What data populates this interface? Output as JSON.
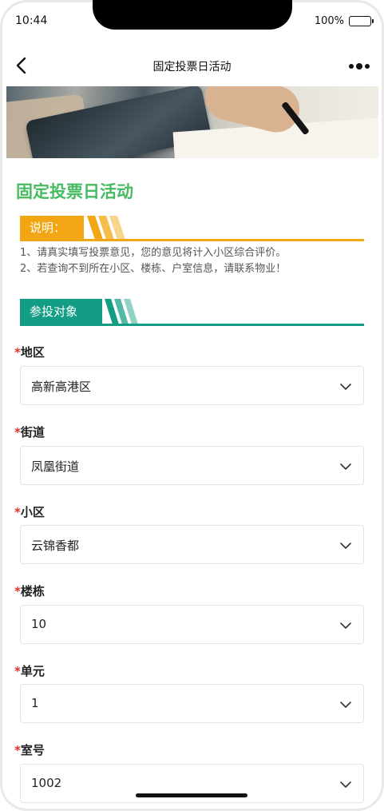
{
  "status_bar": {
    "time": "10:44",
    "battery_percent": "100%",
    "battery_level": 1.0
  },
  "nav": {
    "title": "固定投票日活动",
    "back_icon": "chevron-left-icon",
    "more_icon": "more-dots-icon"
  },
  "page": {
    "title": "固定投票日活动"
  },
  "notice": {
    "header": "说明：",
    "lines": [
      "1、请真实填写投票意见，您的意见将计入小区综合评价。",
      "2、若查询不到所在小区、楼栋、户室信息，请联系物业！"
    ]
  },
  "participant": {
    "header": "参投对象"
  },
  "form": {
    "required_mark": "*",
    "fields": [
      {
        "label": "地区",
        "value": "高新高港区"
      },
      {
        "label": "街道",
        "value": "凤凰街道"
      },
      {
        "label": "小区",
        "value": "云锦香都"
      },
      {
        "label": "楼栋",
        "value": "10"
      },
      {
        "label": "单元",
        "value": "1"
      },
      {
        "label": "室号",
        "value": "1002"
      }
    ]
  },
  "colors": {
    "title_green": "#46bb62",
    "notice_orange": "#f2a614",
    "participant_teal": "#139d84",
    "required_red": "#e0312c"
  }
}
